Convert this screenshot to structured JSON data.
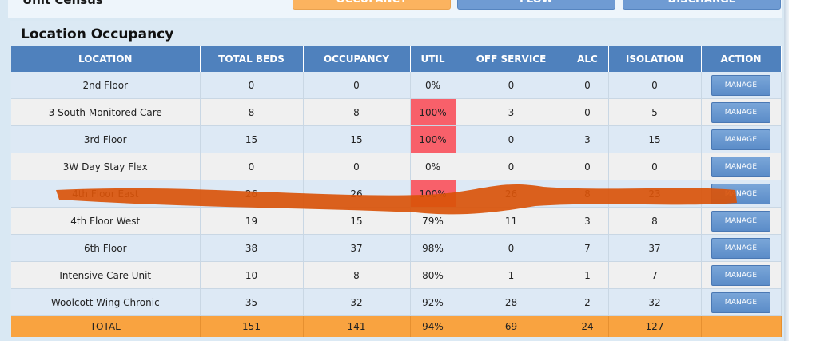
{
  "top": {
    "section_title": "Unit Census",
    "buttons": [
      "OCCUPANCY",
      "FLOW",
      "DISCHARGE"
    ]
  },
  "occupancy": {
    "title": "Location Occupancy",
    "columns": [
      "LOCATION",
      "TOTAL BEDS",
      "OCCUPANCY",
      "UTIL",
      "OFF SERVICE",
      "ALC",
      "ISOLATION",
      "ACTION"
    ],
    "rows": [
      {
        "location": "2nd Floor",
        "total_beds": "0",
        "occupancy": "0",
        "util": "0%",
        "off_service": "0",
        "alc": "0",
        "isolation": "0",
        "action": "MANAGE"
      },
      {
        "location": "3 South Monitored Care",
        "total_beds": "8",
        "occupancy": "8",
        "util": "100%",
        "off_service": "3",
        "alc": "0",
        "isolation": "5",
        "action": "MANAGE"
      },
      {
        "location": "3rd Floor",
        "total_beds": "15",
        "occupancy": "15",
        "util": "100%",
        "off_service": "0",
        "alc": "3",
        "isolation": "15",
        "action": "MANAGE"
      },
      {
        "location": "3W Day Stay Flex",
        "total_beds": "0",
        "occupancy": "0",
        "util": "0%",
        "off_service": "0",
        "alc": "0",
        "isolation": "0",
        "action": "MANAGE"
      },
      {
        "location": "4th Floor East",
        "total_beds": "26",
        "occupancy": "26",
        "util": "100%",
        "off_service": "26",
        "alc": "8",
        "isolation": "23",
        "action": "MANAGE"
      },
      {
        "location": "4th Floor West",
        "total_beds": "19",
        "occupancy": "15",
        "util": "79%",
        "off_service": "11",
        "alc": "3",
        "isolation": "8",
        "action": "MANAGE"
      },
      {
        "location": "6th Floor",
        "total_beds": "38",
        "occupancy": "37",
        "util": "98%",
        "off_service": "0",
        "alc": "7",
        "isolation": "37",
        "action": "MANAGE"
      },
      {
        "location": "Intensive Care Unit",
        "total_beds": "10",
        "occupancy": "8",
        "util": "80%",
        "off_service": "1",
        "alc": "1",
        "isolation": "7",
        "action": "MANAGE"
      },
      {
        "location": "Woolcott Wing Chronic",
        "total_beds": "35",
        "occupancy": "32",
        "util": "92%",
        "off_service": "28",
        "alc": "2",
        "isolation": "32",
        "action": "MANAGE"
      }
    ],
    "total": {
      "location": "TOTAL",
      "total_beds": "151",
      "occupancy": "141",
      "util": "94%",
      "off_service": "69",
      "alc": "24",
      "isolation": "127",
      "action": "-"
    }
  },
  "colors": {
    "header": "#4f81bd",
    "util_alert": "#f8606a",
    "total_row": "#f9a340",
    "scribble": "#d9540a"
  }
}
